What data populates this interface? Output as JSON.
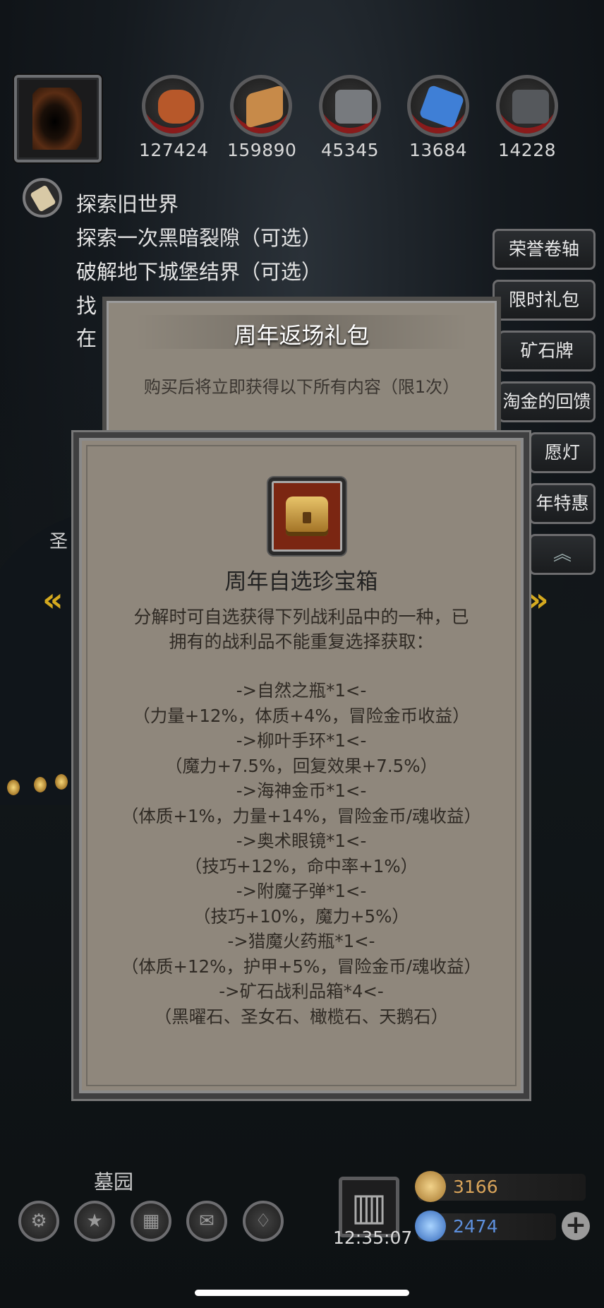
{
  "resources": [
    {
      "name": "meat-icon",
      "value": "127424",
      "color": "#b7582a"
    },
    {
      "name": "wood-icon",
      "value": "159890",
      "color": "#c78a49"
    },
    {
      "name": "iron-icon",
      "value": "45345",
      "color": "#777a7e"
    },
    {
      "name": "crystal-icon",
      "value": "13684",
      "color": "#3f7fd6"
    },
    {
      "name": "ore-icon",
      "value": "14228",
      "color": "#55585c"
    }
  ],
  "quest": {
    "lines": [
      "探索旧世界",
      "探索一次黑暗裂隙（可选）",
      "破解地下城堡结界（可选）",
      "找",
      "在"
    ]
  },
  "right_menu": [
    "荣誉卷轴",
    "限时礼包",
    "矿石牌",
    "淘金的回馈",
    "愿灯",
    "年特惠"
  ],
  "side_labels": {
    "left": "圣"
  },
  "back_panel": {
    "title": "周年返场礼包",
    "subtitle": "购买后将立即获得以下所有内容（限1次）"
  },
  "front_panel": {
    "item_title": "周年自选珍宝箱",
    "desc_line1": "分解时可自选获得下列战利品中的一种，已",
    "desc_line2": "拥有的战利品不能重复选择获取：",
    "entries": [
      {
        "name": "->自然之瓶*1<-",
        "effect": "（力量+12%，体质+4%，冒险金币收益）"
      },
      {
        "name": "->柳叶手环*1<-",
        "effect": "（魔力+7.5%，回复效果+7.5%）"
      },
      {
        "name": "->海神金币*1<-",
        "effect": "（体质+1%，力量+14%，冒险金币/魂收益）"
      },
      {
        "name": "->奥术眼镜*1<-",
        "effect": "（技巧+12%，命中率+1%）"
      },
      {
        "name": "->附魔子弹*1<-",
        "effect": "（技巧+10%，魔力+5%）"
      },
      {
        "name": "->猎魔火药瓶*1<-",
        "effect": "（体质+12%，护甲+5%，冒险金币/魂收益）"
      },
      {
        "name": "->矿石战利品箱*4<-",
        "effect": "（黑曜石、圣女石、橄榄石、天鹅石）"
      }
    ]
  },
  "bottom": {
    "location": "墓园",
    "time": "12:35:07",
    "gold": "3166",
    "gems": "2474"
  },
  "colors": {
    "accent": "#d4a91f",
    "gold_text": "#d9a45a",
    "gem_text": "#5d8fdc"
  }
}
